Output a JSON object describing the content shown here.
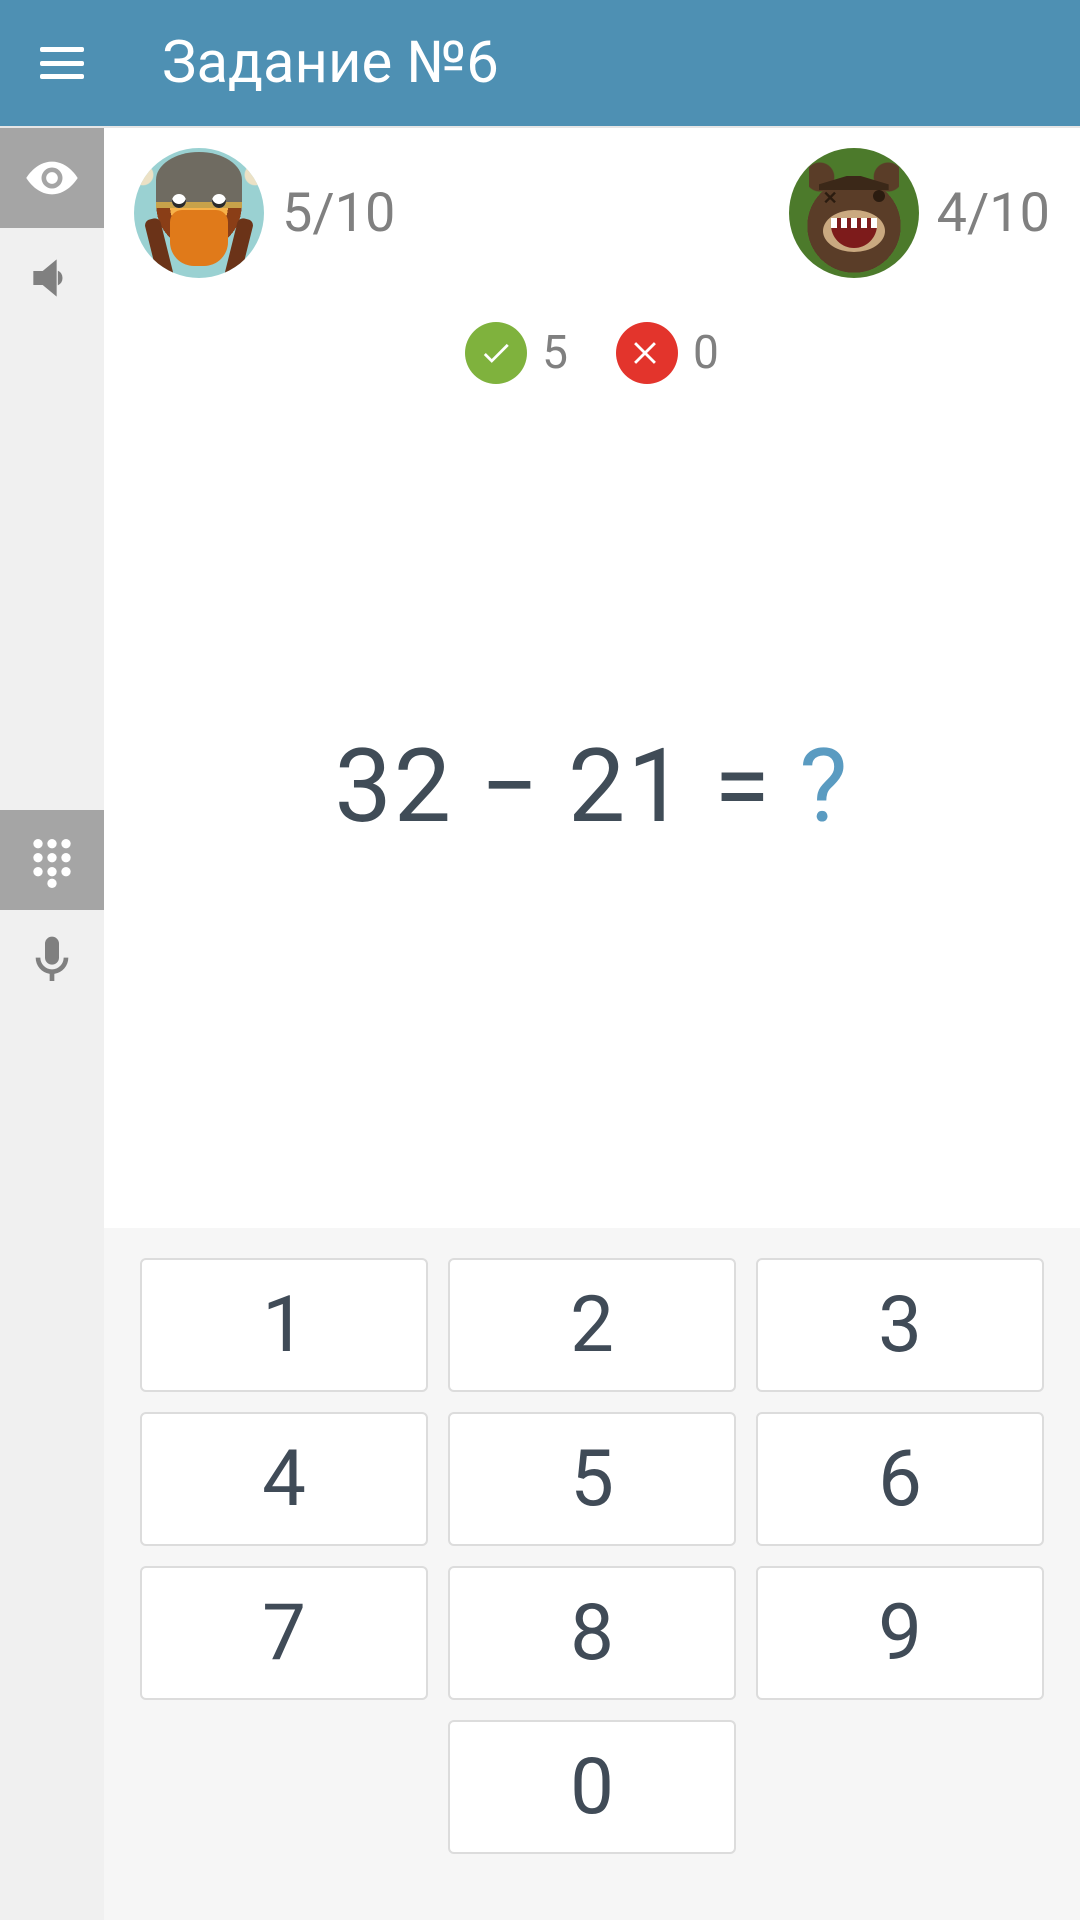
{
  "header": {
    "title": "Задание №6"
  },
  "players": {
    "left": {
      "avatar": "viking",
      "score": "5/10"
    },
    "right": {
      "avatar": "bear",
      "score": "4/10"
    }
  },
  "stats": {
    "correct": "5",
    "incorrect": "0"
  },
  "problem": {
    "expression": "32 − 21 = ",
    "placeholder": "?"
  },
  "keypad": {
    "k1": "1",
    "k2": "2",
    "k3": "3",
    "k4": "4",
    "k5": "5",
    "k6": "6",
    "k7": "7",
    "k8": "8",
    "k9": "9",
    "k0": "0"
  }
}
